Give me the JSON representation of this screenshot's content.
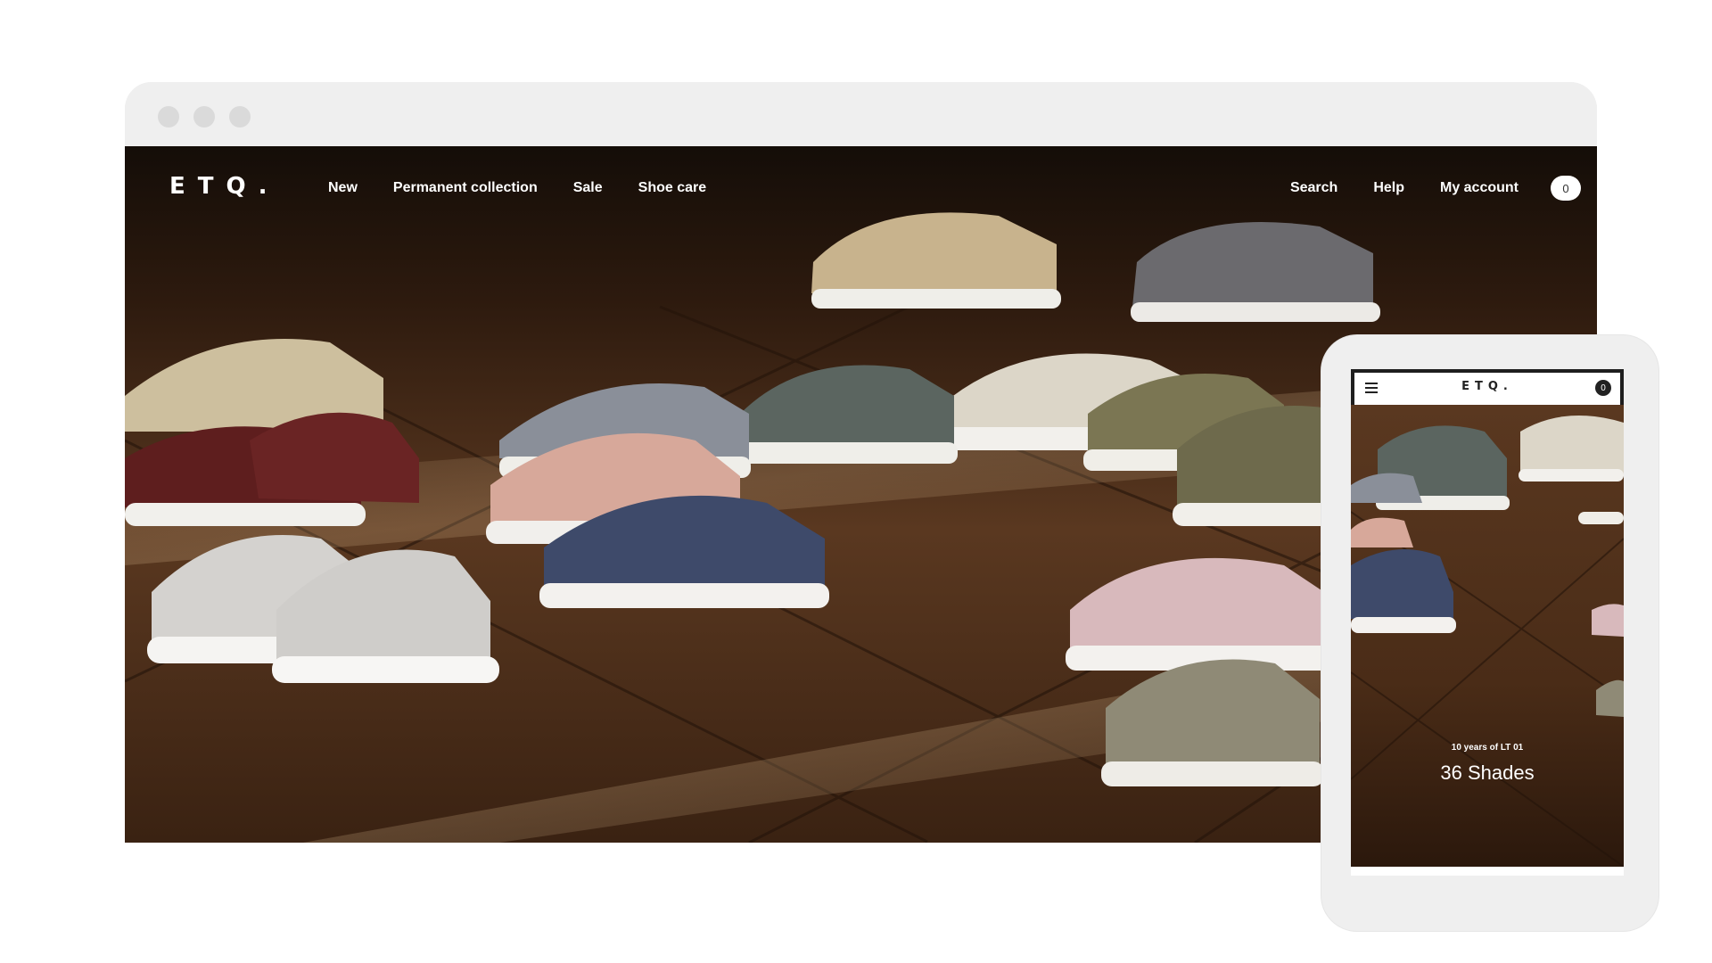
{
  "desktop": {
    "brand": "ETQ.",
    "nav_left": [
      "New",
      "Permanent collection",
      "Sale",
      "Shoe care"
    ],
    "nav_right": [
      "Search",
      "Help",
      "My account"
    ],
    "cart_count": "0"
  },
  "mobile": {
    "brand": "ETQ.",
    "cart_count": "0",
    "kicker": "10 years of LT 01",
    "headline": "36 Shades"
  },
  "colors": {
    "page_bg": "#ffffff",
    "frame_gray": "#efefef",
    "floor_dark": "#3b2414",
    "floor_mid": "#5a3a22",
    "text_light": "#ffffff"
  },
  "icons": {
    "window_controls": [
      "window-dot-icon",
      "window-dot-icon",
      "window-dot-icon"
    ],
    "mobile_menu": "hamburger-menu-icon"
  }
}
